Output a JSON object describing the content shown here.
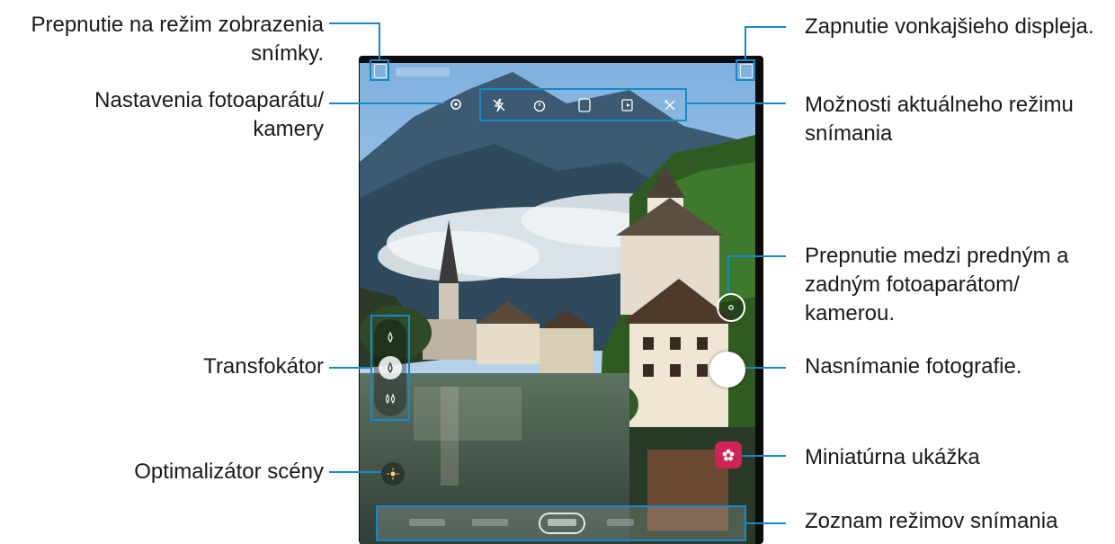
{
  "callouts": {
    "view_mode": "Prepnutie na režim zobrazenia snímky.",
    "outer_display": "Zapnutie vonkajšieho displeja.",
    "settings": "Nastavenia fotoaparátu/ kamery",
    "mode_options": "Možnosti aktuálneho režimu snímania",
    "switch_camera": "Prepnutie medzi predným a zadným fotoaparátom/ kamerou.",
    "capture": "Nasnímanie fotografie.",
    "zoom": "Transfokátor",
    "thumbnail": "Miniatúrna ukážka",
    "optimizer": "Optimalizátor scény",
    "modes_list": "Zoznam režimov snímania"
  },
  "camera_ui": {
    "options_icons": [
      "flash-off-icon",
      "timer-icon",
      "ratio-icon",
      "motion-photo-icon",
      "filters-icon"
    ],
    "zoom_icons": [
      "zoom-tele-icon",
      "zoom-wide-icon",
      "zoom-ultrawide-icon"
    ],
    "zoom_active_index": 1
  },
  "colors": {
    "callout_line": "#1689c9",
    "thumbnail_bg": "#d1235a",
    "shutter": "#ffffff",
    "phone_frame": "#0b0b0b"
  }
}
